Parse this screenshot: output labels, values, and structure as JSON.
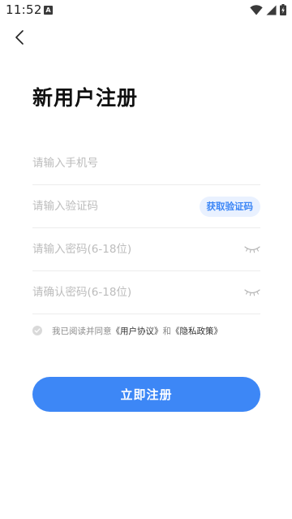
{
  "status_bar": {
    "time": "11:52",
    "notification_icon": "A",
    "icons": [
      "wifi-icon",
      "signal-icon",
      "battery-charging-icon"
    ]
  },
  "header": {
    "back_icon": "chevron-left-icon"
  },
  "page": {
    "title": "新用户注册"
  },
  "form": {
    "phone": {
      "placeholder": "请输入手机号",
      "value": ""
    },
    "code": {
      "placeholder": "请输入验证码",
      "value": "",
      "button_label": "获取验证码"
    },
    "password": {
      "placeholder": "请输入密码(6-18位)",
      "value": "",
      "toggle_icon": "eye-closed-icon"
    },
    "confirm_password": {
      "placeholder": "请确认密码(6-18位)",
      "value": "",
      "toggle_icon": "eye-closed-icon"
    }
  },
  "agreement": {
    "checked": false,
    "prefix": "我已阅读并同意",
    "user_agreement": "《用户协议》",
    "conjunction": "和",
    "privacy_policy": "《隐私政策》"
  },
  "submit": {
    "label": "立即注册"
  },
  "colors": {
    "accent": "#3d87f6",
    "accent_light": "#e9f1ff",
    "placeholder": "#bcbcbc",
    "divider": "#ececec"
  }
}
